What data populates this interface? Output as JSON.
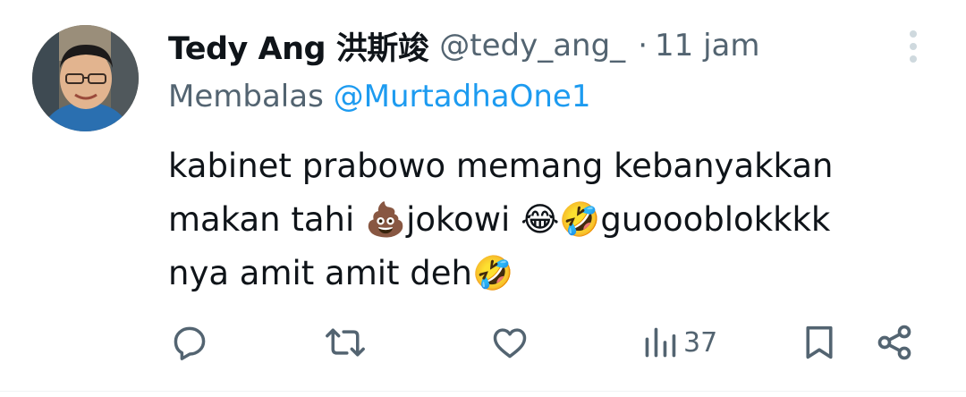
{
  "tweet": {
    "author": {
      "display_name": "Tedy Ang 洪斯竣",
      "handle": "@tedy_ang_",
      "avatar": "profile-photo"
    },
    "separator": "·",
    "time": "11 jam",
    "reply": {
      "prefix": "Membalas",
      "target": "@MurtadhaOne1"
    },
    "text_lines": [
      "kabinet prabowo memang kebanyakkan",
      "makan tahi 💩jokowi 😂🤣guoooblokkkk",
      "nya amit amit deh🤣"
    ],
    "icons": {
      "more": "more-vertical-icon",
      "reply": "reply-icon",
      "retweet": "retweet-icon",
      "like": "heart-icon",
      "views": "views-icon",
      "bookmark": "bookmark-icon",
      "share": "share-icon"
    },
    "stats": {
      "views": "37"
    },
    "colors": {
      "text": "#0f1419",
      "secondary": "#536471",
      "link": "#1d9bf0",
      "icon_more": "#cfd9de"
    }
  }
}
